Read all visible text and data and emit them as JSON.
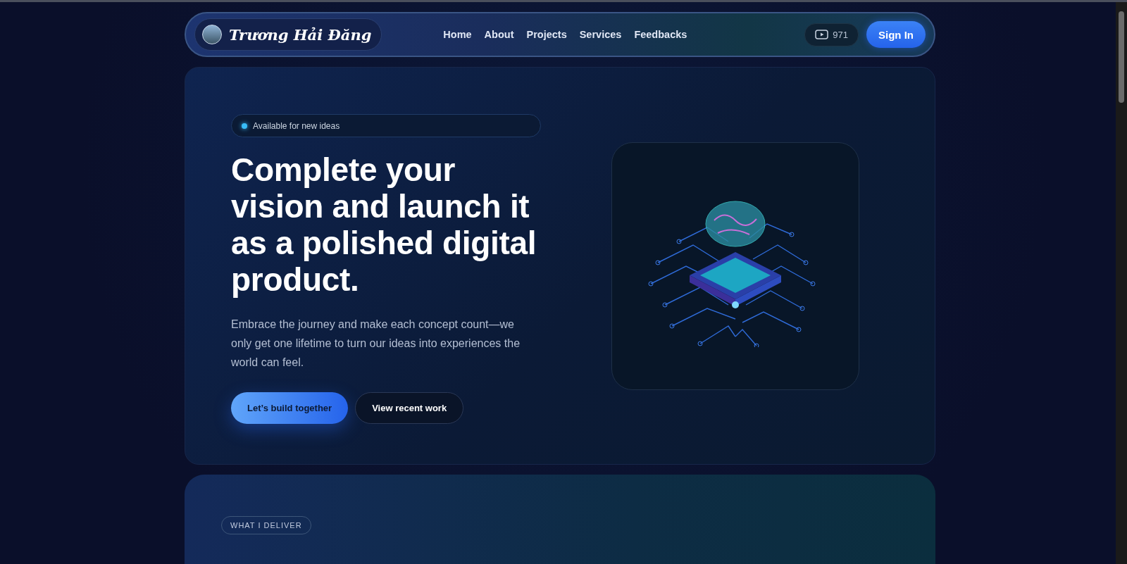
{
  "nav": {
    "brand": "Trương Hải Đăng",
    "links": [
      "Home",
      "About",
      "Projects",
      "Services",
      "Feedbacks"
    ],
    "views": "971",
    "sign_in": "Sign In"
  },
  "hero": {
    "status": "Available for new ideas",
    "title": "Complete your vision and launch it as a polished digital product.",
    "description": "Embrace the journey and make each concept count—we only get one lifetime to turn our ideas into experiences the world can feel.",
    "buttons": [
      {
        "label": "Let’s build together",
        "kind": "primary"
      },
      {
        "label": "View recent work",
        "kind": "secondary"
      }
    ]
  },
  "section": {
    "eyebrow": "WHAT I DELIVER"
  }
}
